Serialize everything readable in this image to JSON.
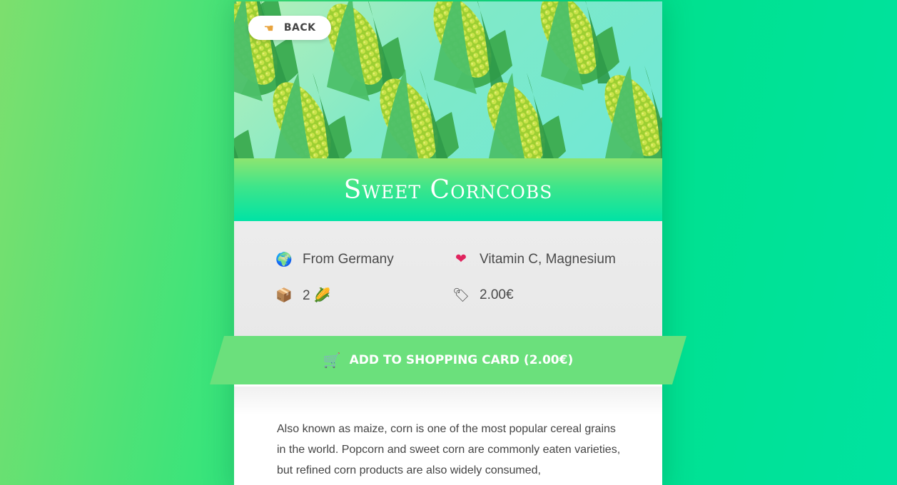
{
  "back_button": {
    "icon": "pointing-hand-icon",
    "label": "BACK"
  },
  "product": {
    "title": "Sweet Corncobs",
    "origin": {
      "icon": "globe-icon",
      "text": "From Germany"
    },
    "nutrients": {
      "icon": "heart-icon",
      "text": "Vitamin C, Magnesium"
    },
    "quantity": {
      "icon": "package-icon",
      "text": "2 🌽"
    },
    "price": {
      "icon": "price-tag-icon",
      "text": "2.00€"
    }
  },
  "cart_button": {
    "icon": "shopping-cart-icon",
    "label": "ADD TO SHOPPING CARD (2.00€)"
  },
  "description": "Also known as maize, corn is one of the most popular cereal grains in the world. Popcorn and sweet corn are commonly eaten varieties, but refined corn products are also widely consumed,",
  "colors": {
    "accent": "#6be07c",
    "title_band": "#00e3a5"
  }
}
